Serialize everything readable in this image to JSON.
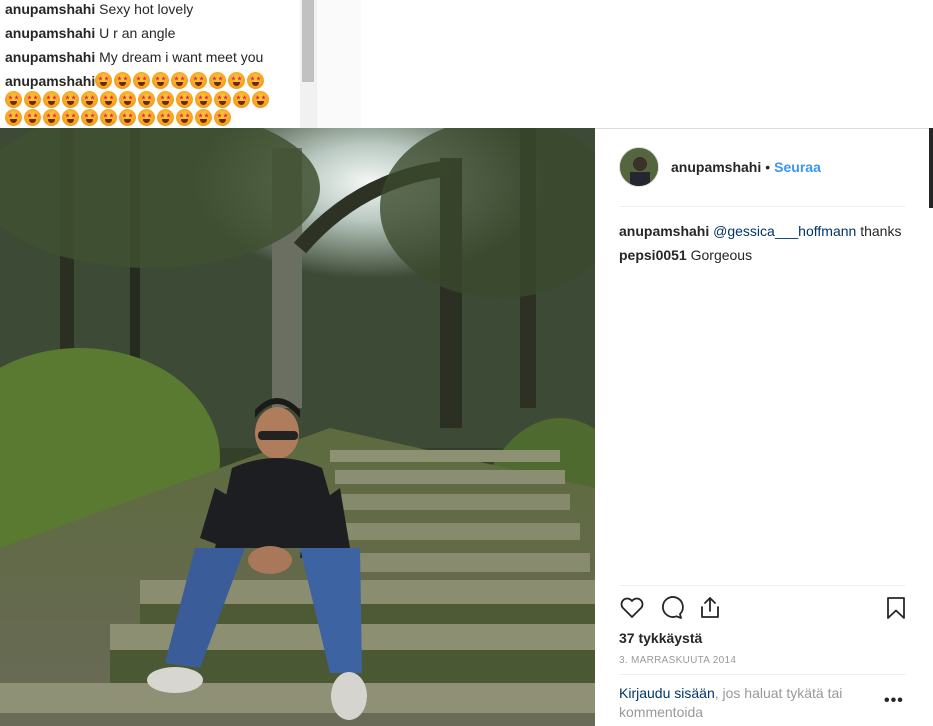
{
  "top_comments": [
    {
      "user": "anupamshahi",
      "text": "Sexy hot lovely"
    },
    {
      "user": "anupamshahi",
      "text": "U r an angle"
    },
    {
      "user": "anupamshahi",
      "text": "My dream i want meet you"
    },
    {
      "user": "anupamshahi",
      "text": ""
    }
  ],
  "emoji_icon": "star-struck-face-emoji",
  "post": {
    "username": "anupamshahi",
    "separator": "•",
    "follow_label": "Seuraa",
    "comments": [
      {
        "user": "anupamshahi",
        "mention": "@gessica___hoffmann",
        "text": " thanks"
      },
      {
        "user": "pepsi0051",
        "mention": "",
        "text": " Gorgeous"
      }
    ],
    "likes": "37 tykkäystä",
    "date": "3. MARRASKUUTA 2014",
    "login_link": "Kirjaudu sisään",
    "login_text": ", jos haluat tykätä tai kommentoida",
    "more_label": "•••"
  },
  "colors": {
    "follow": "#3897f0",
    "mention": "#003569",
    "text": "#262626",
    "muted": "#999999"
  }
}
